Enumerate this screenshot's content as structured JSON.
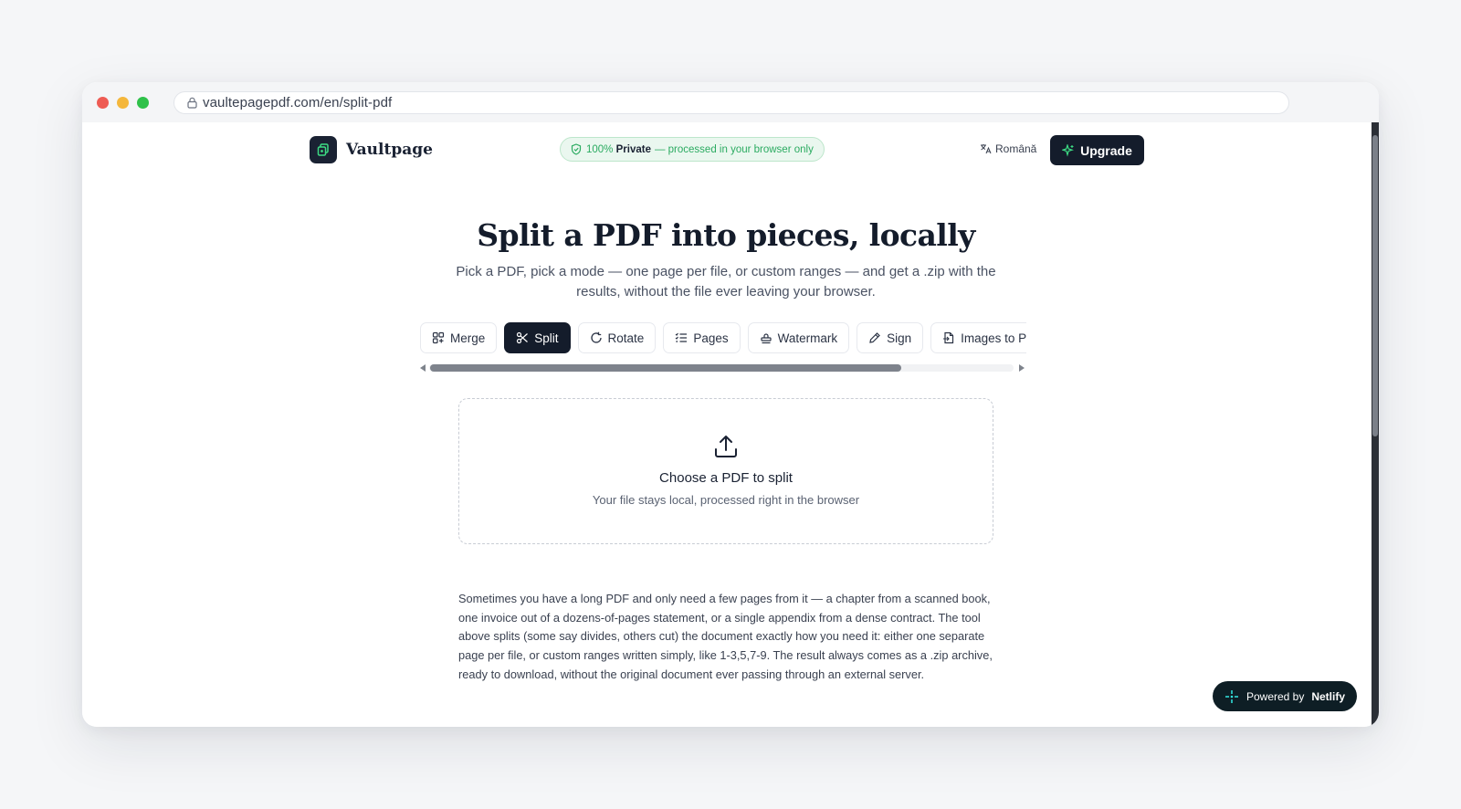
{
  "browser": {
    "url": "vaultepagepdf.com/en/split-pdf"
  },
  "nav": {
    "brand": "Vaultpage",
    "privacy_strong": "100% Private",
    "privacy_prefix": "100% Private",
    "privacy_rest": "— processed in your browser only",
    "language": "Română",
    "upgrade_label": "Upgrade"
  },
  "hero": {
    "title": "Split a PDF into pieces, locally",
    "subtitle": "Pick a PDF, pick a mode — one page per file, or custom ranges — and get a .zip with the results, without the file ever leaving your browser."
  },
  "tools": {
    "tabs": [
      {
        "label": "Merge",
        "icon": "merge-icon"
      },
      {
        "label": "Split",
        "icon": "scissors-icon",
        "active": true
      },
      {
        "label": "Rotate",
        "icon": "rotate-icon"
      },
      {
        "label": "Pages",
        "icon": "pages-list-icon"
      },
      {
        "label": "Watermark",
        "icon": "stamp-icon"
      },
      {
        "label": "Sign",
        "icon": "signature-icon"
      },
      {
        "label": "Images to PDF",
        "icon": "image-file-icon"
      }
    ]
  },
  "dropzone": {
    "title": "Choose a PDF to split",
    "subtitle": "Your file stays local, processed right in the browser"
  },
  "content": {
    "paragraph": "Sometimes you have a long PDF and only need a few pages from it — a chapter from a scanned book, one invoice out of a dozens-of-pages statement, or a single appendix from a dense contract. The tool above splits (some say divides, others cut) the document exactly how you need it: either one separate page per file, or custom ranges written simply, like 1-3,5,7-9. The result always comes as a .zip archive, ready to download, without the original document ever passing through an external server."
  },
  "badge": {
    "prefix": "Powered by",
    "brand": "Netlify"
  },
  "colors": {
    "dark": "#141c2b",
    "privacy_green": "#2bab61",
    "window_bg": "#f5f6f8"
  }
}
